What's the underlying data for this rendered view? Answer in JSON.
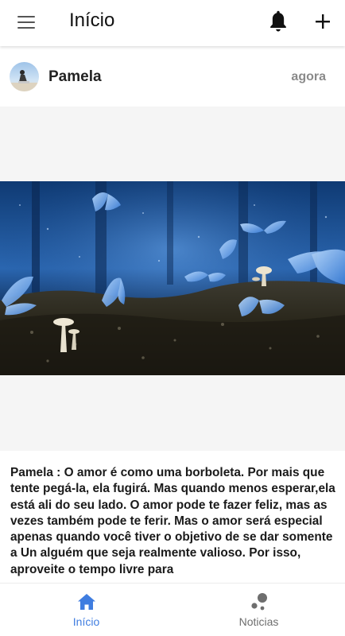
{
  "header": {
    "title": "Início",
    "menu_icon": "menu-icon",
    "notifications_icon": "bell-icon",
    "add_icon": "plus-icon"
  },
  "post": {
    "author": "Pamela",
    "time": "agora",
    "image_description": "butterfly-mushroom-image",
    "text": "Pamela : O amor é como uma borboleta. Por mais que tente pegá-la, ela fugirá. Mas quando menos esperar,ela está ali do seu lado. O amor pode te fazer feliz, mas as vezes também pode te ferir. Mas o amor será especial apenas quando você tiver o objetivo de se dar somente a Un alguém que seja realmente valioso. Por isso, aproveite o tempo livre para"
  },
  "bottom_nav": {
    "items": [
      {
        "label": "Início",
        "icon": "home-icon",
        "active": true
      },
      {
        "label": "Noticias",
        "icon": "bubbles-icon",
        "active": false
      }
    ]
  },
  "colors": {
    "accent": "#3f7de0",
    "inactive": "#6e6e6e",
    "background": "#f5f5f5"
  }
}
